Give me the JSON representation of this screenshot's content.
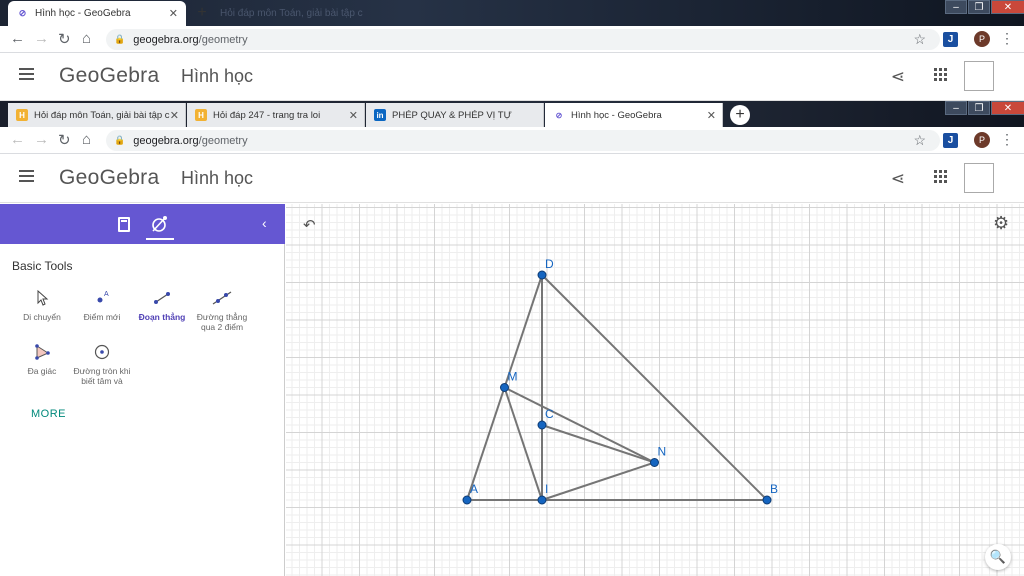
{
  "outer_browser": {
    "tabs": [
      {
        "title": "Hình học - GeoGebra",
        "active": true
      },
      {
        "title": "Hỏi đáp môn Toán, giải bài tập c",
        "active": false
      }
    ],
    "url_domain": "geogebra.org",
    "url_path": "/geometry",
    "avatar_letter": "P",
    "ext_letter": "J"
  },
  "inner_browser": {
    "tabs": [
      {
        "title": "Hỏi đáp môn Toán, giải bài tập c",
        "icon": "H"
      },
      {
        "title": "Hỏi đáp 247 - trang tra loi",
        "icon": "H"
      },
      {
        "title": "PHÉP QUAY & PHÉP VỊ TỰ",
        "icon": "in"
      },
      {
        "title": "Hình học - GeoGebra",
        "icon": "gg"
      }
    ],
    "url_domain": "geogebra.org",
    "url_path": "/geometry",
    "avatar_letter": "P",
    "ext_letter": "J"
  },
  "app": {
    "logo": "GeoGebra",
    "title": "Hình học"
  },
  "panel": {
    "section_title": "Basic Tools",
    "tools": [
      {
        "label": "Di chuyển",
        "selected": false
      },
      {
        "label": "Điểm mới",
        "selected": false
      },
      {
        "label": "Đoạn thẳng",
        "selected": true
      },
      {
        "label": "Đường thẳng qua 2 điểm",
        "selected": false
      },
      {
        "label": "Đa giác",
        "selected": false
      },
      {
        "label": "Đường tròn khi biết tâm và",
        "selected": false
      }
    ],
    "more_label": "MORE"
  },
  "colors": {
    "accent": "#6557d2",
    "point_fill": "#1565c0",
    "segment": "#757575",
    "label": "#1565c0"
  },
  "geometry": {
    "points": [
      {
        "name": "A",
        "x": 0,
        "y": 0
      },
      {
        "name": "I",
        "x": 2,
        "y": 0
      },
      {
        "name": "B",
        "x": 8,
        "y": 0
      },
      {
        "name": "D",
        "x": 2,
        "y": 6
      },
      {
        "name": "M",
        "x": 1,
        "y": 3
      },
      {
        "name": "C",
        "x": 2,
        "y": 2
      },
      {
        "name": "N",
        "x": 5,
        "y": 1
      }
    ],
    "segments": [
      [
        "A",
        "B"
      ],
      [
        "A",
        "D"
      ],
      [
        "D",
        "B"
      ],
      [
        "D",
        "I"
      ],
      [
        "M",
        "I"
      ],
      [
        "M",
        "N"
      ],
      [
        "C",
        "N"
      ],
      [
        "I",
        "N"
      ]
    ]
  }
}
